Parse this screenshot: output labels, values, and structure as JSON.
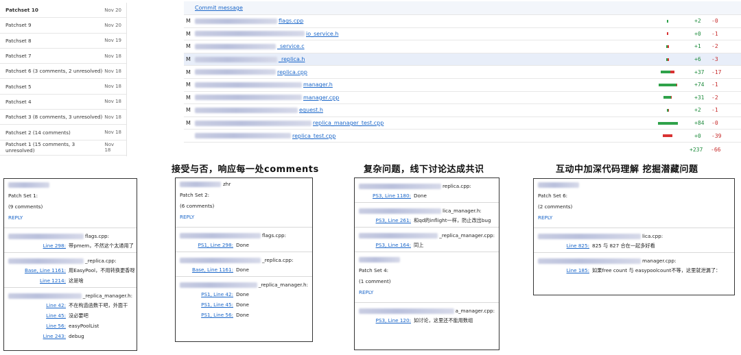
{
  "patchsets": [
    {
      "label": "Patchset 10",
      "date": "Nov 20",
      "active": true
    },
    {
      "label": "Patchset 9",
      "date": "Nov 20"
    },
    {
      "label": "Patchset 8",
      "date": "Nov 19"
    },
    {
      "label": "Patchset 7",
      "date": "Nov 18"
    },
    {
      "label": "Patchset 6 (3 comments, 2 unresolved)",
      "date": "Nov 18"
    },
    {
      "label": "Patchset 5",
      "date": "Nov 18"
    },
    {
      "label": "Patchset 4",
      "date": "Nov 18"
    },
    {
      "label": "Patchset 3 (8 comments, 3 unresolved)",
      "date": "Nov 18"
    },
    {
      "label": "Patchset 2 (14 comments)",
      "date": "Nov 18"
    },
    {
      "label": "Patchset 1 (15 comments, 3 unresolved)",
      "date": "Nov 18"
    }
  ],
  "files_table": {
    "commit_message_link": "Commit message",
    "files": [
      {
        "status": "M",
        "name": "flags.cpp",
        "adds": "+2",
        "dels": "-0",
        "add_ratio": 0.05,
        "del_ratio": 0
      },
      {
        "status": "M",
        "name": "io_service.h",
        "adds": "+0",
        "dels": "-1",
        "add_ratio": 0,
        "del_ratio": 0.05
      },
      {
        "status": "M",
        "name": "_service.c",
        "adds": "+1",
        "dels": "-2",
        "add_ratio": 0.05,
        "del_ratio": 0.05
      },
      {
        "status": "M",
        "name": "_replica.h",
        "adds": "+6",
        "dels": "-3",
        "add_ratio": 0.07,
        "del_ratio": 0.05,
        "highlight": true
      },
      {
        "status": "M",
        "name": "replica.cpp",
        "adds": "+37",
        "dels": "-17",
        "add_ratio": 0.45,
        "del_ratio": 0.2
      },
      {
        "status": "M",
        "name": "manager.h",
        "adds": "+74",
        "dels": "-1",
        "add_ratio": 0.85,
        "del_ratio": 0.02
      },
      {
        "status": "M",
        "name": "manager.cpp",
        "adds": "+31",
        "dels": "-2",
        "add_ratio": 0.38,
        "del_ratio": 0.04
      },
      {
        "status": "M",
        "name": "equest.h",
        "adds": "+2",
        "dels": "-1",
        "add_ratio": 0.05,
        "del_ratio": 0.03
      },
      {
        "status": "M",
        "name": "replica_manager_test.cpp",
        "adds": "+84",
        "dels": "-0",
        "add_ratio": 0.95,
        "del_ratio": 0
      },
      {
        "status": "",
        "name": "replica_test.cpp",
        "adds": "+0",
        "dels": "-39",
        "add_ratio": 0,
        "del_ratio": 0.45
      }
    ],
    "total_adds": "+237",
    "total_dels": "-66"
  },
  "captions": [
    "接受与否，响应每一处comments",
    "复杂问题，线下讨论达成共识",
    "互动中加深代码理解 挖掘潜藏问题"
  ],
  "panels": [
    {
      "header": {
        "patch_set": "Patch Set 1:",
        "comments": "(9 comments)",
        "reply": "REPLY"
      },
      "groups": [
        {
          "file": "flags.cpp:",
          "comments": [
            {
              "loc": "Line 298:",
              "msg": "带pmem，不然这个太通用了"
            }
          ]
        },
        {
          "file": "_replica.cpp:",
          "comments": [
            {
              "loc": "Base, Line 1161:",
              "msg": "用EasyPool，不用转换更香呀"
            },
            {
              "loc": "Line 1214:",
              "msg": "这是啥"
            }
          ]
        },
        {
          "file": "_replica_manager.h:",
          "comments": [
            {
              "loc": "Line 42:",
              "msg": "不在构造函数干吧，外面干"
            },
            {
              "loc": "Line 45:",
              "msg": "没必要吧"
            },
            {
              "loc": "Line 56:",
              "msg": "easyPoolList"
            },
            {
              "loc": "Line 243:",
              "msg": "debug"
            }
          ]
        }
      ]
    },
    {
      "header": {
        "author": "zhr",
        "patch_set": "Patch Set 2:",
        "comments": "(6 comments)",
        "reply": "REPLY"
      },
      "groups": [
        {
          "file": "flags.cpp:",
          "comments": [
            {
              "loc": "PS1, Line 298:",
              "msg": "Done"
            }
          ]
        },
        {
          "file": "_replica.cpp:",
          "comments": [
            {
              "loc": "Base, Line 1161:",
              "msg": "Done"
            }
          ]
        },
        {
          "file": "_replica_manager.h:",
          "comments": [
            {
              "loc": "PS1, Line 42:",
              "msg": "Done"
            },
            {
              "loc": "PS1, Line 45:",
              "msg": "Done"
            },
            {
              "loc": "PS1, Line 56:",
              "msg": "Done"
            }
          ]
        }
      ]
    },
    {
      "groups_top": [
        {
          "file": "replica.cpp:",
          "comments": [
            {
              "loc": "PS3, Line 1180:",
              "msg": "Done"
            }
          ]
        },
        {
          "file": "lica_manager.h:",
          "comments": [
            {
              "loc": "PS3, Line 261:",
              "msg": "和qd的inflight一样，防止改出bug"
            }
          ]
        },
        {
          "file": "_replica_manager.cpp:",
          "comments": [
            {
              "loc": "PS3, Line 164:",
              "msg": "同上"
            }
          ]
        }
      ],
      "header": {
        "patch_set": "Patch Set 4:",
        "comments": "(1 comment)",
        "reply": "REPLY"
      },
      "groups": [
        {
          "file": "a_manager.cpp:",
          "comments": [
            {
              "loc": "PS3, Line 120:",
              "msg": "如讨论，这里还不能用数组"
            }
          ]
        }
      ]
    },
    {
      "header": {
        "patch_set": "Patch Set 6:",
        "comments": "(2 comments)",
        "reply": "REPLY"
      },
      "groups": [
        {
          "file": "lica.cpp:",
          "comments": [
            {
              "loc": "Line 825:",
              "msg": "825 与 827 合在一起多好看"
            }
          ]
        },
        {
          "file": "manager.cpp:",
          "comments": [
            {
              "loc": "Line 185:",
              "msg": "如果free count 与 easypoolcount不等，这里就泄漏了："
            }
          ]
        }
      ]
    }
  ]
}
